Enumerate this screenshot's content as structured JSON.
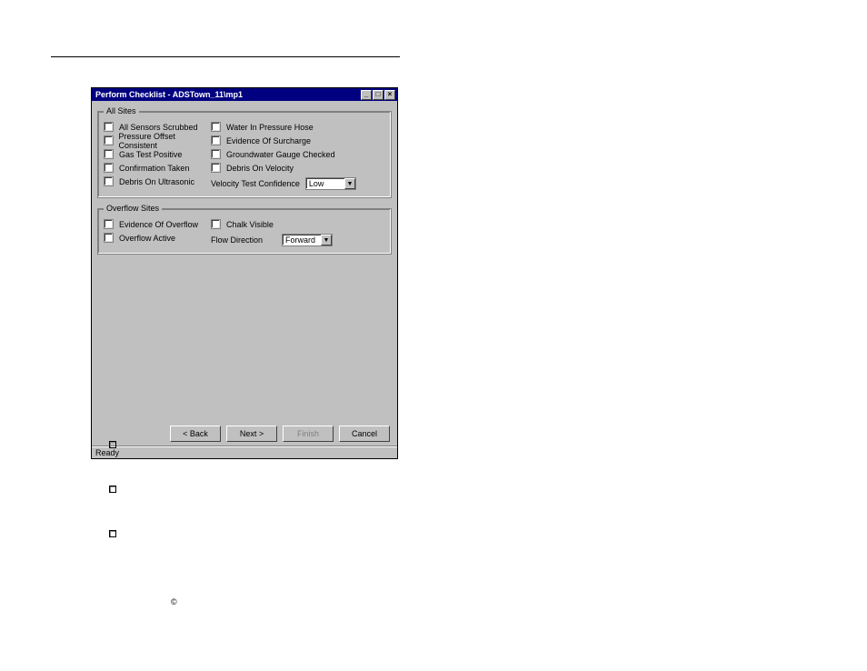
{
  "window": {
    "title": "Perform Checklist - ADSTown_11\\mp1",
    "buttons": {
      "back": "< Back",
      "next": "Next >",
      "finish": "Finish",
      "cancel": "Cancel"
    },
    "status": "Ready"
  },
  "allSites": {
    "legend": "All Sites",
    "left": [
      "All Sensors Scrubbed",
      "Pressure Offset Consistent",
      "Gas Test Positive",
      "Confirmation Taken",
      "Debris On Ultrasonic"
    ],
    "right": [
      "Water In Pressure Hose",
      "Evidence Of Surcharge",
      "Groundwater Gauge Checked",
      "Debris On Velocity"
    ],
    "confidenceLabel": "Velocity Test Confidence",
    "confidenceValue": "Low"
  },
  "overflowSites": {
    "legend": "Overflow Sites",
    "left": [
      "Evidence Of Overflow",
      "Overflow Active"
    ],
    "rightCheckbox": "Chalk Visible",
    "flowLabel": "Flow Direction",
    "flowValue": "Forward"
  },
  "icons": {
    "min": "_",
    "max": "□",
    "close": "×",
    "down": "▼",
    "copyright": "©"
  },
  "bullets": {
    "b1": "",
    "b2": "",
    "b3": ""
  }
}
